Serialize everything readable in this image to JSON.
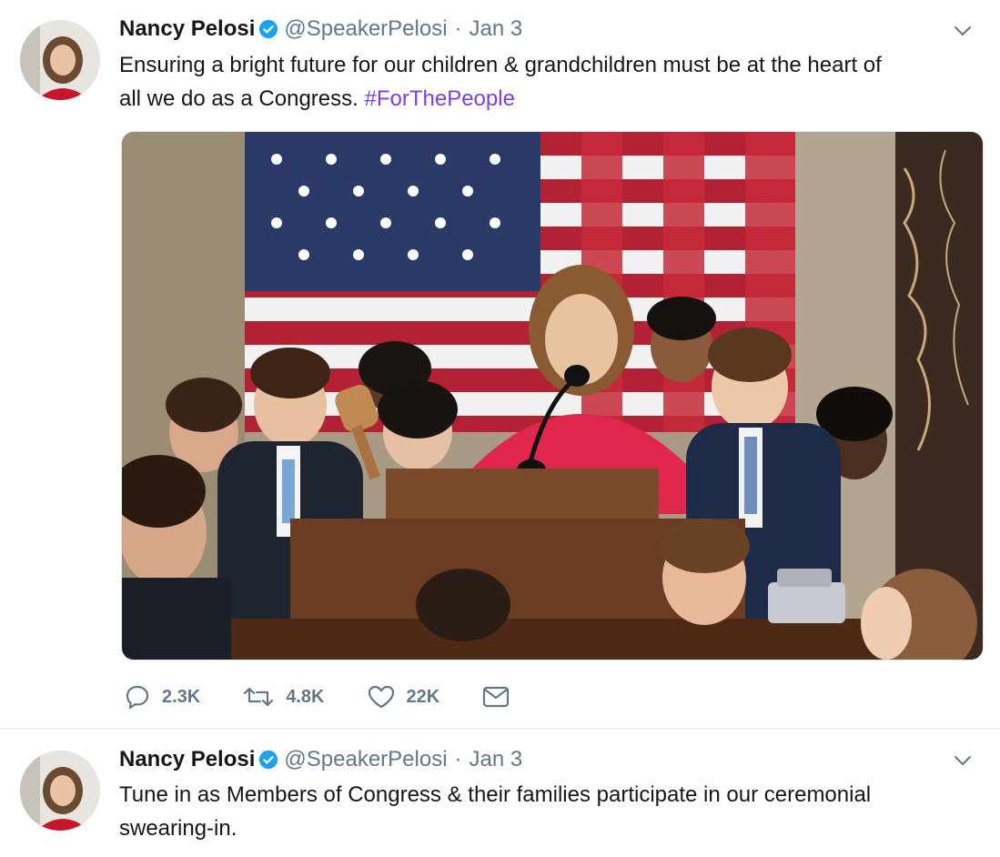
{
  "tweets": [
    {
      "author": {
        "name": "Nancy Pelosi",
        "handle": "@SpeakerPelosi",
        "date": "Jan 3",
        "verified": true
      },
      "text_line1": "Ensuring a bright future for our children & grandchildren must be at the heart of",
      "text_line2": "all we do as a Congress.",
      "hashtag": "#ForThePeople",
      "stats": {
        "replies": "2.3K",
        "retweets": "4.8K",
        "likes": "22K"
      },
      "media": "photo"
    },
    {
      "author": {
        "name": "Nancy Pelosi",
        "handle": "@SpeakerPelosi",
        "date": "Jan 3",
        "verified": true
      },
      "text_line1": "Tune in as Members of Congress & their families participate in our ceremonial",
      "text_line2": "swearing-in."
    }
  ],
  "colors": {
    "link": "#7a3ff0",
    "verified": "#1da1f2",
    "muted": "#657786",
    "text": "#14171a"
  },
  "icons": [
    "verified-badge-icon",
    "chevron-down-icon",
    "reply-icon",
    "retweet-icon",
    "like-icon",
    "message-icon"
  ]
}
